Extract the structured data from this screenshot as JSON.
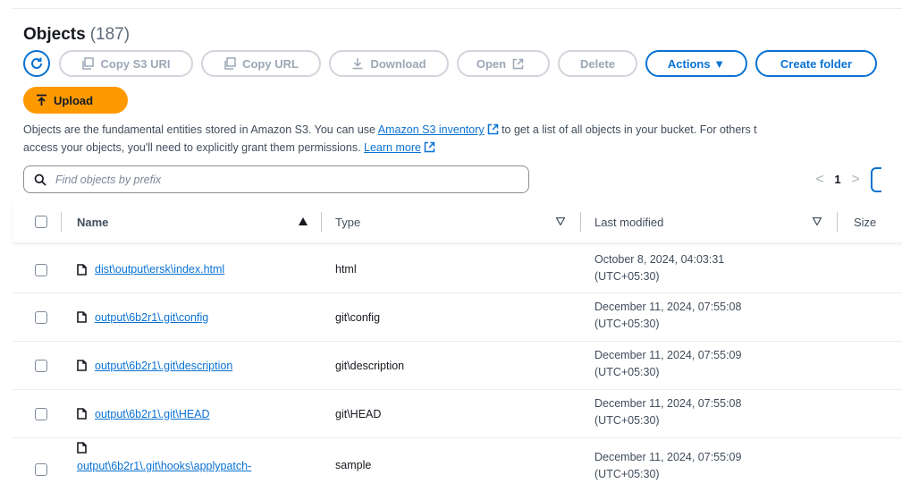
{
  "header": {
    "title": "Objects",
    "count": "(187)"
  },
  "toolbar": {
    "copy_s3_uri": "Copy S3 URI",
    "copy_url": "Copy URL",
    "download": "Download",
    "open": "Open",
    "delete": "Delete",
    "actions": "Actions ▼",
    "create_folder": "Create folder",
    "upload": "Upload"
  },
  "description": {
    "part1": "Objects are the fundamental entities stored in Amazon S3. You can use ",
    "link1": "Amazon S3 inventory",
    "part2": " to get a list of all objects in your bucket. For others t",
    "part3": "access your objects, you'll need to explicitly grant them permissions. ",
    "link2": "Learn more"
  },
  "search": {
    "placeholder": "Find objects by prefix"
  },
  "pagination": {
    "prev": "<",
    "page": "1",
    "next": ">"
  },
  "columns": {
    "name": "Name",
    "type": "Type",
    "last_modified": "Last modified",
    "size": "Size"
  },
  "rows": [
    {
      "name": "dist\\output\\ersk\\index.html",
      "type": "html",
      "modified_date": "October 8, 2024, 04:03:31",
      "modified_tz": "(UTC+05:30)"
    },
    {
      "name": "output\\6b2r1\\.git\\config",
      "type": "git\\config",
      "modified_date": "December 11, 2024, 07:55:08",
      "modified_tz": "(UTC+05:30)"
    },
    {
      "name": "output\\6b2r1\\.git\\description",
      "type": "git\\description",
      "modified_date": "December 11, 2024, 07:55:09",
      "modified_tz": "(UTC+05:30)"
    },
    {
      "name": "output\\6b2r1\\.git\\HEAD",
      "type": "git\\HEAD",
      "modified_date": "December 11, 2024, 07:55:08",
      "modified_tz": "(UTC+05:30)"
    },
    {
      "name": "output\\6b2r1\\.git\\hooks\\applypatch-",
      "type": "sample",
      "modified_date": "December 11, 2024, 07:55:09",
      "modified_tz": "(UTC+05:30)"
    }
  ],
  "colors": {
    "accent": "#0972d3",
    "upload": "#ff9900"
  }
}
